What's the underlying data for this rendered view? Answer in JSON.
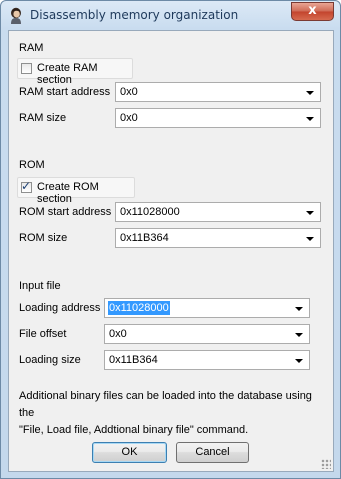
{
  "window": {
    "title": "Disassembly memory organization",
    "close_glyph": "x"
  },
  "ram": {
    "heading": "RAM",
    "create_label": "Create RAM section",
    "create_checked": false,
    "start_label": "RAM start address",
    "start_value": "0x0",
    "size_label": "RAM size",
    "size_value": "0x0"
  },
  "rom": {
    "heading": "ROM",
    "create_label": "Create ROM section",
    "create_checked": true,
    "start_label": "ROM start address",
    "start_value": "0x11028000",
    "size_label": "ROM size",
    "size_value": "0x11B364"
  },
  "input_file": {
    "heading": "Input file",
    "loading_address_label": "Loading address",
    "loading_address_value": "0x11028000",
    "file_offset_label": "File offset",
    "file_offset_value": "0x0",
    "loading_size_label": "Loading size",
    "loading_size_value": "0x11B364"
  },
  "note": {
    "line1": "Additional binary files can be loaded into the database using the",
    "line2": "\"File, Load file, Addtional binary file\" command."
  },
  "buttons": {
    "ok": "OK",
    "cancel": "Cancel"
  },
  "icons": {
    "app": "ida-hexrays-person-icon",
    "checkmark": "checkmark-icon",
    "dropdown": "chevron-down-icon"
  },
  "colors": {
    "selection": "#3399ff",
    "close_button": "#c3442d",
    "dialog_background": "#f0f0f0"
  }
}
